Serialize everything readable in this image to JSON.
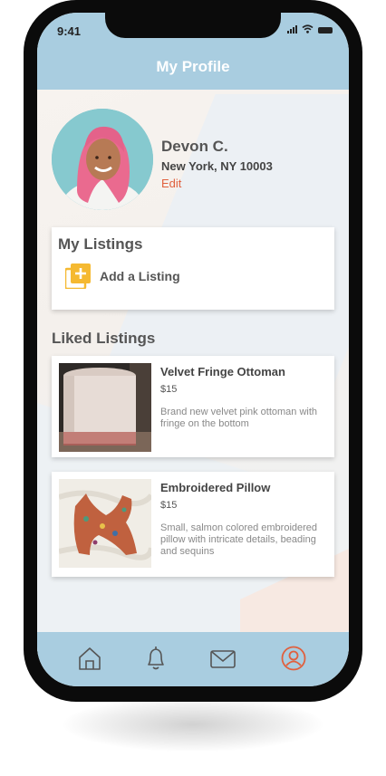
{
  "status_bar": {
    "time": "9:41"
  },
  "header": {
    "title": "My Profile"
  },
  "profile": {
    "name": "Devon C.",
    "location": "New York, NY 10003",
    "edit_label": "Edit"
  },
  "my_listings": {
    "title": "My Listings",
    "add_label": "Add a Listing"
  },
  "liked_listings": {
    "title": "Liked Listings",
    "items": [
      {
        "name": "Velvet Fringe Ottoman",
        "price": "$15",
        "description": "Brand new velvet pink ottoman with fringe on the bottom"
      },
      {
        "name": "Embroidered Pillow",
        "price": "$15",
        "description": "Small, salmon colored embroidered pillow with intricate details, beading and sequins"
      }
    ]
  },
  "tab_bar": {
    "items": [
      {
        "icon": "home-icon"
      },
      {
        "icon": "bell-icon"
      },
      {
        "icon": "mail-icon"
      },
      {
        "icon": "profile-icon",
        "active": true
      }
    ]
  },
  "colors": {
    "header_bg": "#a9cde0",
    "accent": "#e0603e",
    "add_icon": "#f5b931"
  }
}
